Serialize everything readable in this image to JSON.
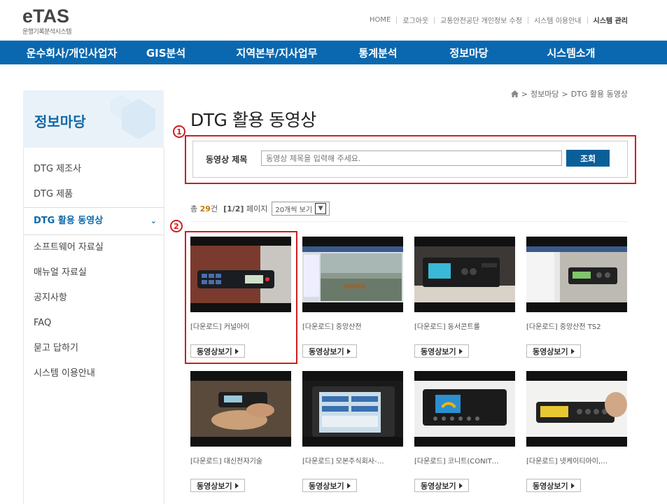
{
  "header": {
    "logo_title": "eTAS",
    "logo_sub": "운행기록분석시스템",
    "util_links": [
      "HOME",
      "로그아웃",
      "교통안전공단 개인정보 수정",
      "시스템 이용안내",
      "시스템 관리"
    ]
  },
  "gnb": [
    "운수회사/개인사업자",
    "GIS분석",
    "지역본부/지사업무",
    "통계분석",
    "정보마당",
    "시스템소개"
  ],
  "sidebar": {
    "title": "정보마당",
    "items": [
      "DTG 제조사",
      "DTG 제품",
      "DTG 활용 동영상",
      "소프트웨어 자료실",
      "매뉴얼 자료실",
      "공지사항",
      "FAQ",
      "묻고 답하기",
      "시스템 이용안내"
    ],
    "active_index": 2
  },
  "breadcrumb": [
    "정보마당",
    "DTG 활용 동영상"
  ],
  "page_title": "DTG 활용 동영상",
  "markers": [
    "1",
    "2"
  ],
  "search": {
    "label": "동영상 제목",
    "placeholder": "동영상 제목을 입력해 주세요.",
    "button": "조회"
  },
  "list_info": {
    "prefix": "총",
    "count": "29",
    "suffix": "건",
    "page": "[1/2]",
    "page_label": "페이지",
    "per_page": "20개씩 보기"
  },
  "video_button_label": "동영상보기",
  "videos": [
    {
      "title": "[다운로드] 커널아이"
    },
    {
      "title": "[다운로드] 중앙산전"
    },
    {
      "title": "[다운로드] 동서콘트롤"
    },
    {
      "title": "[다운로드] 중앙산전 TS2"
    },
    {
      "title": "[다운로드] 대신전자기술"
    },
    {
      "title": "[다운로드] 모본주식회사-…"
    },
    {
      "title": "[다운로드] 코니트(CONIT…"
    },
    {
      "title": "[다운로드] 넷케이티아이,…"
    }
  ],
  "colors": {
    "nav_blue": "#0a68b0",
    "highlight_red": "#cc1f1f",
    "count_orange": "#c47a00"
  }
}
